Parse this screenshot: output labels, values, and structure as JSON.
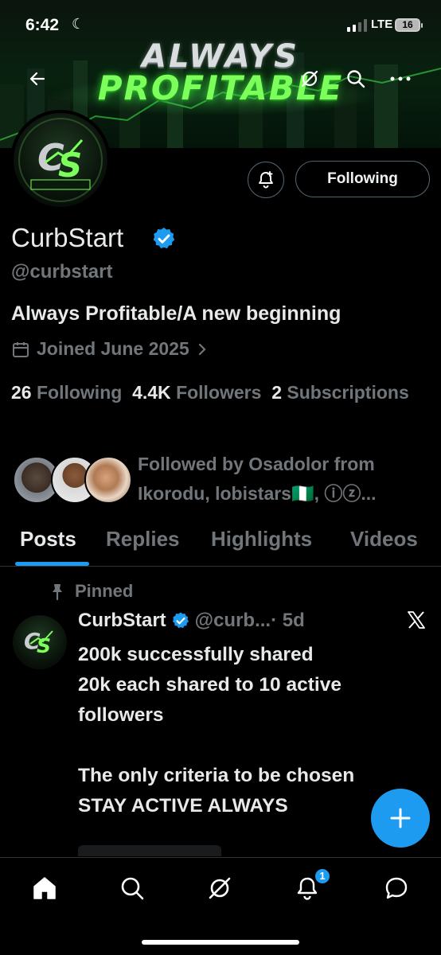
{
  "status_bar": {
    "time": "6:42",
    "network": "LTE",
    "battery": "16"
  },
  "banner": {
    "line1": "ALWAYS",
    "line2": "PROFITABLE"
  },
  "profile": {
    "display_name": "CurbStart",
    "handle": "@curbstart",
    "bio": "Always Profitable/A new beginning",
    "joined": "Joined June 2025",
    "following_count": "26",
    "following_label": "Following",
    "followers_count": "4.4K",
    "followers_label": "Followers",
    "subscriptions_count": "2",
    "subscriptions_label": "Subscriptions",
    "followed_by": "Followed by Osadolor from Ikorodu, lobistars🇳🇬, ⓘⓩ..."
  },
  "actions": {
    "following_button": "Following"
  },
  "tabs": [
    {
      "label": "Posts",
      "active": true
    },
    {
      "label": "Replies",
      "active": false
    },
    {
      "label": "Highlights",
      "active": false
    },
    {
      "label": "Videos",
      "active": false
    }
  ],
  "pinned_post": {
    "pinned_label": "Pinned",
    "author": "CurbStart",
    "handle": "@curb...",
    "time": "· 5d",
    "body": "200k successfully shared\n20k each shared to 10 active followers\n\nThe only criteria to be chosen\nSTAY ACTIVE ALWAYS"
  },
  "bottom_nav": {
    "notification_count": "1"
  },
  "colors": {
    "accent": "#1d9bf0",
    "muted": "#71767b",
    "text": "#e7e9ea",
    "banner_green": "#7cff5a"
  }
}
